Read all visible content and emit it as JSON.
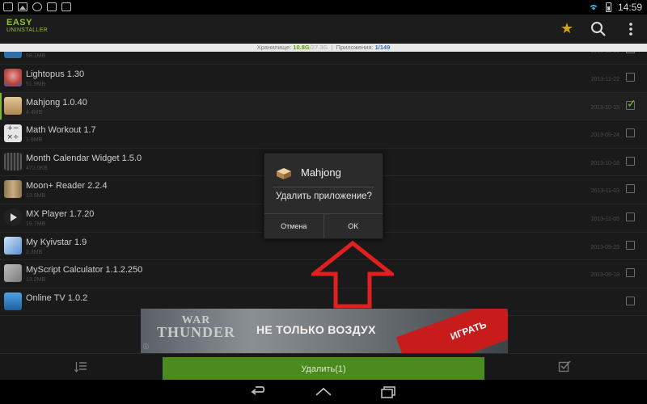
{
  "status_bar": {
    "time": "14:59"
  },
  "app_bar": {
    "logo_line1": "EASY",
    "logo_line2": "UNINSTALLER",
    "icons": [
      "star-icon",
      "search-icon",
      "overflow-menu-icon"
    ]
  },
  "storage": {
    "storage_label": "Хранилище:",
    "storage_used": "10.8G",
    "storage_total": "/27.3G",
    "separator": "|",
    "apps_label": "Приложения:",
    "apps_selected": "1",
    "apps_total": "/149"
  },
  "apps": [
    {
      "name": "",
      "size": "58.1MB",
      "date": "2013-11-15",
      "checked": false,
      "icon_color": "#2f6fa8"
    },
    {
      "name": "Lightopus 1.30",
      "size": "51.9MB",
      "date": "2013-11-22",
      "checked": false,
      "icon_color": "#b8433c"
    },
    {
      "name": "Mahjong 1.0.40",
      "size": "4.4MB",
      "date": "2013-10-15",
      "checked": true,
      "icon_color": "#c9a36c"
    },
    {
      "name": "Math Workout 1.7",
      "size": "1.6MB",
      "date": "2013-09-24",
      "checked": false,
      "icon_color": "#9a9a9a"
    },
    {
      "name": "Month Calendar Widget 1.5.0",
      "size": "472.0KB",
      "date": "2013-10-18",
      "checked": false,
      "icon_color": "#3a3a3a"
    },
    {
      "name": "Moon+ Reader 2.2.4",
      "size": "13.9MB",
      "date": "2013-11-03",
      "checked": false,
      "icon_color": "#a38a62"
    },
    {
      "name": "MX Player 1.7.20",
      "size": "19.7MB",
      "date": "2013-11-05",
      "checked": false,
      "icon_color": "#2a2a2a"
    },
    {
      "name": "My Kyivstar 1.9",
      "size": "2.3MB",
      "date": "2013-09-23",
      "checked": false,
      "icon_color": "#5a8fcf"
    },
    {
      "name": "MyScript Calculator 1.1.2.250",
      "size": "13.2MB",
      "date": "2013-09-19",
      "checked": false,
      "icon_color": "#8c8c8c"
    },
    {
      "name": "Online TV 1.0.2",
      "size": "",
      "date": "",
      "checked": false,
      "icon_color": "#2d7bc4"
    }
  ],
  "ad": {
    "logo_line1": "WAR",
    "logo_line2": "THUNDER",
    "headline": "НЕ ТОЛЬКО ВОЗДУХ",
    "cta": "ИГРАТЬ",
    "info": "ⓘ"
  },
  "bottom_bar": {
    "delete_label": "Удалить(1)"
  },
  "dialog": {
    "title": "Mahjong",
    "message": "Удалить приложение?",
    "cancel_label": "Отмена",
    "ok_label": "OK"
  },
  "colors": {
    "accent_green": "#4b8a1d",
    "check_green": "#7bc236",
    "annotation_red": "#e0201f",
    "star_gold": "#d4a40a"
  }
}
